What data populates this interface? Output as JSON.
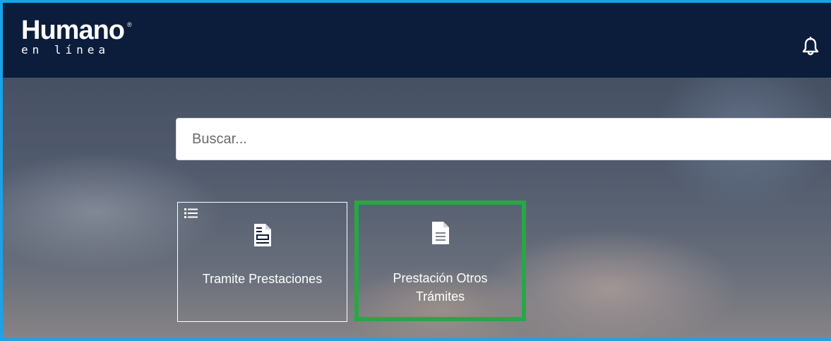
{
  "header": {
    "logo_main": "Humano",
    "logo_registered": "®",
    "logo_sub": "en línea",
    "notifications_icon": "bell-icon"
  },
  "search": {
    "placeholder": "Buscar..."
  },
  "tiles": [
    {
      "title": "Tramite Prestaciones",
      "icon": "document-form-icon",
      "menu_icon": "list-icon"
    },
    {
      "title": "Prestación Otros Trámites",
      "icon": "document-icon"
    }
  ],
  "colors": {
    "header_bg": "#0c1c3b",
    "frame_border": "#1aa3e8",
    "highlight": "#28a745"
  }
}
